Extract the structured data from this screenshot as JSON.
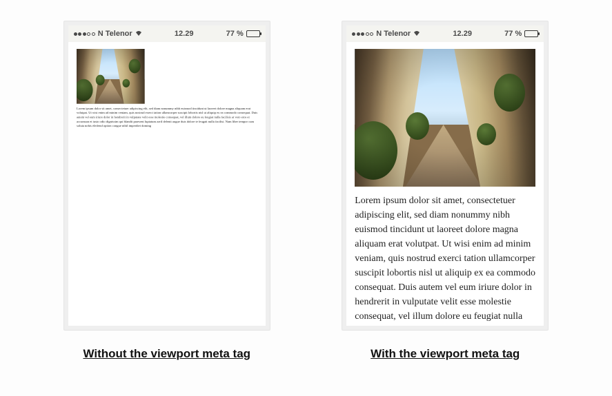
{
  "status": {
    "carrier": "N Telenor",
    "time": "12.29",
    "battery_pct": "77 %"
  },
  "content": {
    "lorem": "Lorem ipsum dolor sit amet, consectetuer adipiscing elit, sed diam nonummy nibh euismod tincidunt ut laoreet dolore magna aliquam erat volutpat. Ut wisi enim ad minim veniam, quis nostrud exerci tation ullamcorper suscipit lobortis nisl ut aliquip ex ea commodo consequat. Duis autem vel eum iriure dolor in hendrerit in vulputate velit esse molestie consequat, vel illum dolore eu feugiat nulla facilisis at vero eros et accumsan et iusto odio dignissim qui blandit praesent luptatum zzril delenit augue duis dolore te feugait nulla facilisi. Nam liber tempor cum soluta nobis eleifend option congue nihil imperdiet doming"
  },
  "captions": {
    "left": "Without the viewport meta tag",
    "right": "With the viewport meta tag"
  }
}
